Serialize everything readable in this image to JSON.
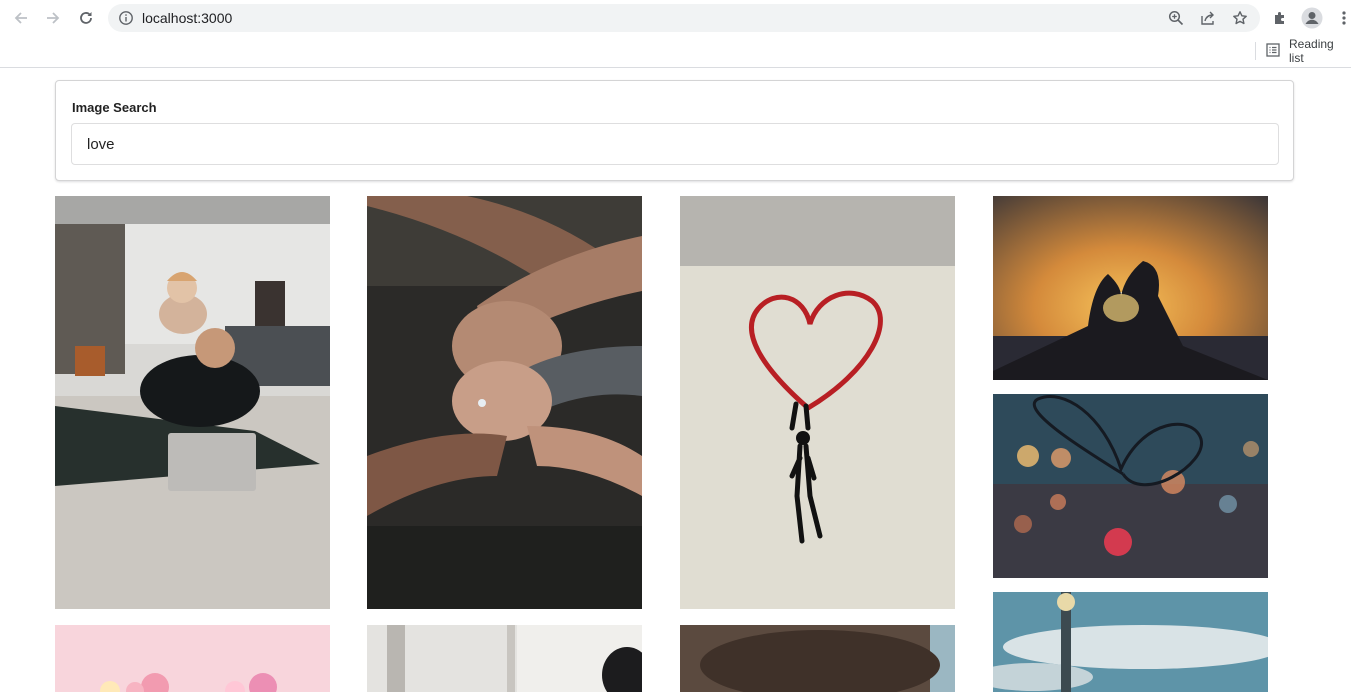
{
  "browser": {
    "url": "localhost:3000",
    "reading_list_label": "Reading list",
    "icons": [
      "back-icon",
      "forward-icon",
      "reload-icon",
      "site-info-icon",
      "zoom-icon",
      "share-icon",
      "bookmark-star-icon",
      "extensions-icon",
      "profile-icon",
      "menu-icon",
      "reading-list-icon"
    ]
  },
  "search": {
    "label": "Image Search",
    "value": "love"
  },
  "results": [
    {
      "subject": "family with toddler on father's back looking at laptop"
    },
    {
      "subject": "clasped hands with ring"
    },
    {
      "subject": "red heart graffiti with hanging figure"
    },
    {
      "subject": "hands forming heart against sunset"
    },
    {
      "subject": "heart drawn on glass with bokeh lights"
    },
    {
      "subject": "pink roses on pink background"
    },
    {
      "subject": "window interior with person"
    },
    {
      "subject": "blurred brown close-up"
    },
    {
      "subject": "street lamp against cloudy sky"
    }
  ]
}
